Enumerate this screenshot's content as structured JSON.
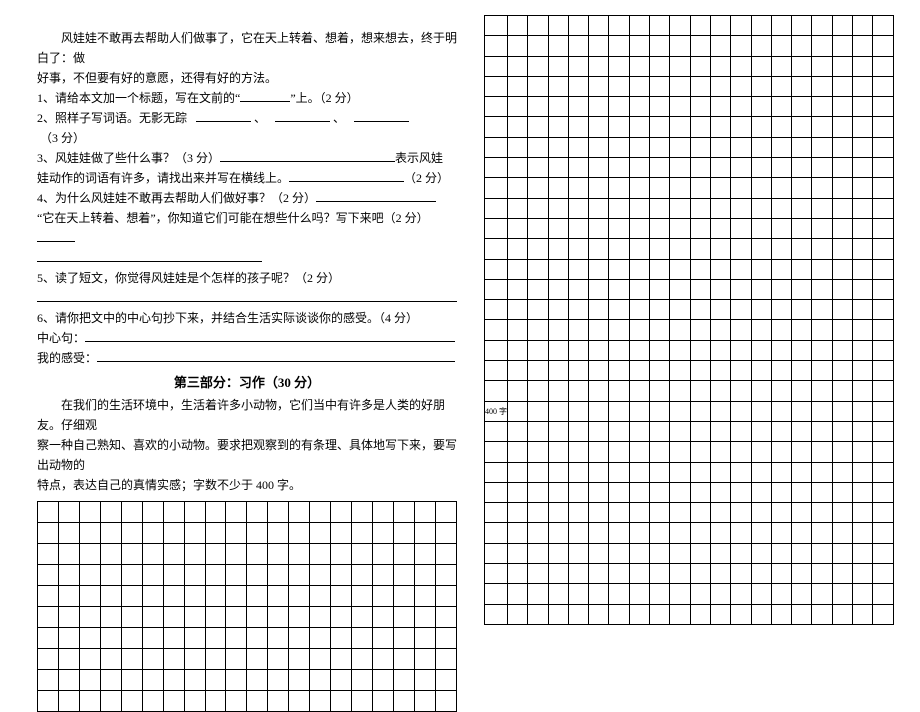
{
  "left": {
    "para1a": "风娃娃不敢再去帮助人们做事了，它在天上转着、想着，想来想去，终于明白了：做",
    "para1b": "好事，不但要有好的意愿，还得有好的方法。",
    "q1a": "1、请给本文加一个标题，写在文前的“",
    "q1b": "”上。（2 分）",
    "q2a": "2、照样子写词语。无影无踪",
    "q2b": "、",
    "q2c": "、",
    "q2d": "（3 分）",
    "q3a": "3、风娃娃做了些什么事？（3 分）",
    "q3b": "表示风娃",
    "q3c": "娃动作的词语有许多，请找出来并写在横线上。",
    "q3d": "（2 分）",
    "q4a": "4、为什么风娃娃不敢再去帮助人们做好事？（2 分）",
    "q4b": "“它在天上转着、想着”，你知道它们可能在想些什么吗？写下来吧（2 分）",
    "q5a": "5、读了短文，你觉得风娃娃是个怎样的孩子呢？（2 分）",
    "q6a": "6、请你把文中的中心句抄下来，并结合生活实际谈谈你的感受。（4 分）",
    "q6b": "中心句：",
    "q6c": "我的感受：",
    "sectionTitle": "第三部分：习作（30 分）",
    "essay1": "在我们的生活环境中，生活着许多小动物，它们当中有许多是人类的好朋友。仔细观",
    "essay2": "察一种自己熟知、喜欢的小动物。要求把观察到的有条理、具体地写下来，要写出动物的",
    "essay3": "特点，表达自己的真情实感；字数不少于 400 字。"
  },
  "rightGrid": {
    "marker": "400 字"
  }
}
